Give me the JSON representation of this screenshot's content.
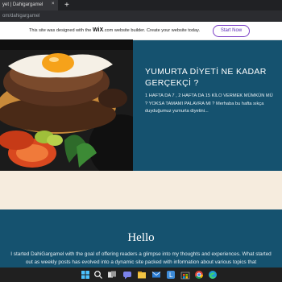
{
  "browser": {
    "tab_title": "yet | Dahigargamel",
    "tab_close": "×",
    "new_tab": "+",
    "url": "om/dahigargamel"
  },
  "banner": {
    "text_before": "This site was designed with the ",
    "brand": "WiX",
    "text_after": ".com website builder. Create your website today.",
    "button": "Start Now"
  },
  "post": {
    "title": "YUMURTA DİYETİ NE KADAR GERÇEKÇİ ?",
    "excerpt": "1 HAFTA DA 7 , 2 HAFTA DA 15 KİLO VERMEK MÜMKÜN MÜ ? YOKSA TAMAMI PALAVRA MI ? Merhaba bu hafta sıkça duyduğumuz yumurta diyetini..."
  },
  "about": {
    "title": "Hello",
    "body": "I started DahiGargamel with the goal of offering readers a glimpse into my thoughts and experiences. What started out as weekly posts has evolved into a dynamic site packed with information about various topics that"
  },
  "taskbar": {
    "icons": [
      "windows-start-icon",
      "search-icon",
      "task-view-icon",
      "chat-icon",
      "file-explorer-icon",
      "mail-icon",
      "photos-icon",
      "store-icon",
      "chrome-icon",
      "edge-icon"
    ]
  },
  "colors": {
    "brand_blue": "#15526f",
    "cream": "#f6ecde",
    "button_purple": "#5b2ab8"
  }
}
